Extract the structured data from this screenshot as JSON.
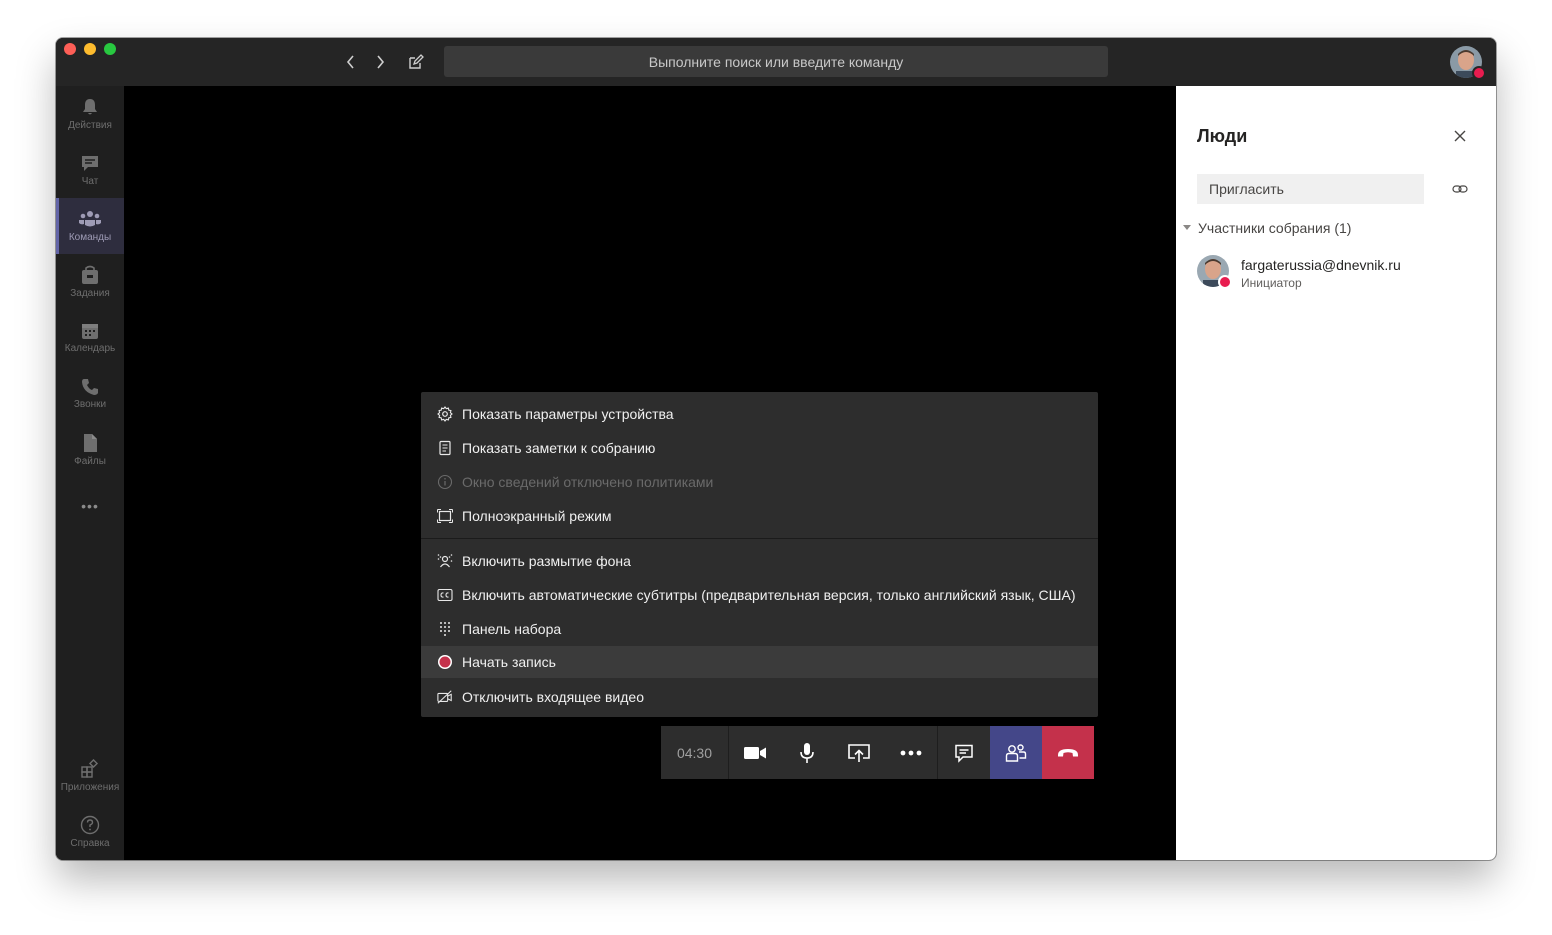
{
  "titlebar": {
    "search_placeholder": "Выполните поиск или введите команду"
  },
  "rail": {
    "items": [
      {
        "label": "Действия",
        "icon": "bell-icon"
      },
      {
        "label": "Чат",
        "icon": "chat-icon"
      },
      {
        "label": "Команды",
        "icon": "teams-icon"
      },
      {
        "label": "Задания",
        "icon": "assignments-icon"
      },
      {
        "label": "Календарь",
        "icon": "calendar-icon"
      },
      {
        "label": "Звонки",
        "icon": "phone-icon"
      },
      {
        "label": "Файлы",
        "icon": "file-icon"
      }
    ],
    "more_label": "•••",
    "apps_label": "Приложения",
    "help_label": "Справка"
  },
  "menu": {
    "items": [
      {
        "label": "Показать параметры устройства",
        "icon": "gear-icon"
      },
      {
        "label": "Показать заметки к собранию",
        "icon": "notes-icon"
      },
      {
        "label": "Окно сведений отключено политиками",
        "icon": "info-icon",
        "disabled": true
      },
      {
        "label": "Полноэкранный режим",
        "icon": "fullscreen-icon"
      },
      {
        "label": "Включить размытие фона",
        "icon": "blur-icon"
      },
      {
        "label": "Включить автоматические субтитры (предварительная версия, только английский язык, США)",
        "icon": "cc-icon"
      },
      {
        "label": "Панель набора",
        "icon": "dialpad-icon"
      },
      {
        "label": "Начать запись",
        "icon": "record-icon",
        "highlighted": true
      },
      {
        "label": "Отключить входящее видео",
        "icon": "video-off-icon"
      }
    ]
  },
  "callbar": {
    "timer": "04:30"
  },
  "panel": {
    "title": "Люди",
    "invite_placeholder": "Пригласить",
    "section_label": "Участники собрания (1)",
    "participants": [
      {
        "name": "fargaterussia@dnevnik.ru",
        "role": "Инициатор"
      }
    ]
  },
  "colors": {
    "accent": "#6264a7",
    "hangup": "#c4314b",
    "record": "#c4314b",
    "busy": "#e81c4f"
  }
}
